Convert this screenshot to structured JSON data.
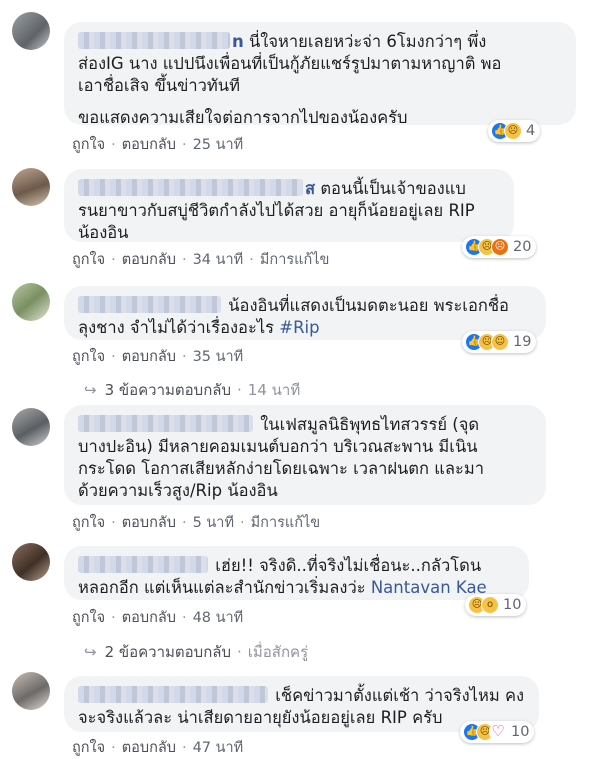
{
  "comments": [
    {
      "name_visible": "n",
      "text_lines": [
        "นี่ใจหายเลยหว่ะจ่า 6โมงกว่าๆ พึ่ง",
        "ส่องIG นาง แปปนึงเพื่อนที่เป็นกู้ภัยแชร์รูปมาตามหาญาติ พอ",
        "เอาชื่อเสิจ ขึ้นข่าวทันที",
        "ขอแสดงความเสียใจต่อการจากไปของน้องครับ"
      ],
      "like_label": "ถูกใจ",
      "reply_label": "ตอบกลับ",
      "time": "25 นาที",
      "edited": "",
      "reaction_count": "4",
      "reaction_icons": [
        "like-icon",
        "sad-icon"
      ]
    },
    {
      "name_visible": "ส",
      "text_lines": [
        "ตอนนี้เป็นเจ้าของแบ",
        "รนยาขาวกับสบู่ชีวิตกำลังไปได้สวย อายุก็น้อยอยู่เลย RIP",
        "น้องอิน"
      ],
      "like_label": "ถูกใจ",
      "reply_label": "ตอบกลับ",
      "time": "34 นาที",
      "edited": "มีการแก้ไข",
      "reaction_count": "20",
      "reaction_icons": [
        "like-icon",
        "sad-icon",
        "angry-icon"
      ]
    },
    {
      "name_visible": "",
      "text_lines": [
        "น้องอินที่แสดงเป็นมดตะนอย พระเอกชื่อ",
        "ลุงชาง จำไม่ได้ว่าเรื่องอะไร"
      ],
      "hashtag": "#Rip",
      "like_label": "ถูกใจ",
      "reply_label": "ตอบกลับ",
      "time": "35 นาที",
      "edited": "",
      "reaction_count": "19",
      "reaction_icons": [
        "like-icon",
        "sad-icon",
        "haha-icon"
      ],
      "replies_label": "3 ข้อความตอบกลับ",
      "replies_time": "14 นาที"
    },
    {
      "name_visible": "",
      "text_lines": [
        "ในเฟสมูลนิธิพุทธไทสวรรย์ (จุด",
        "บางปะอิน) มีหลายคอมเมนต์บอกว่า บริเวณสะพาน มีเนิน",
        "กระโดด โอกาสเสียหลักง่ายโดยเฉพาะ เวลาฝนตก และมา",
        "ด้วยความเร็วสูง/Rip น้องอิน"
      ],
      "like_label": "ถูกใจ",
      "reply_label": "ตอบกลับ",
      "time": "5 นาที",
      "edited": "มีการแก้ไข"
    },
    {
      "name_visible": "",
      "text_lines": [
        "เฮ่ย!! จริงดิ..ที่จริงไม่เชื่อนะ..กลัวโดน",
        "หลอกอีก แต่เห็นแต่ละสำนักข่าวเริ่มลงว่ะ"
      ],
      "mention": "Nantavan Kae",
      "like_label": "ถูกใจ",
      "reply_label": "ตอบกลับ",
      "time": "48 นาที",
      "edited": "",
      "reaction_count": "10",
      "reaction_icons": [
        "sad-icon",
        "wow-icon"
      ],
      "replies_label": "2 ข้อความตอบกลับ",
      "replies_time": "เมื่อสักครู่"
    },
    {
      "name_visible": "",
      "text_lines": [
        "เช็คข่าวมาตั้งแต่เช้า ว่าจริงไหม คง",
        "จะจริงแล้วละ น่าเสียดายอายุยังน้อยอยู่เลย RIP ครับ"
      ],
      "like_label": "ถูกใจ",
      "reply_label": "ตอบกลับ",
      "time": "47 นาที",
      "edited": "",
      "reaction_count": "10",
      "reaction_icons": [
        "like-icon",
        "sad-icon",
        "love-icon"
      ]
    }
  ],
  "colors": {
    "bubble": "#f2f3f5",
    "link": "#385898",
    "meta": "#606770",
    "like": "#1877f2"
  }
}
